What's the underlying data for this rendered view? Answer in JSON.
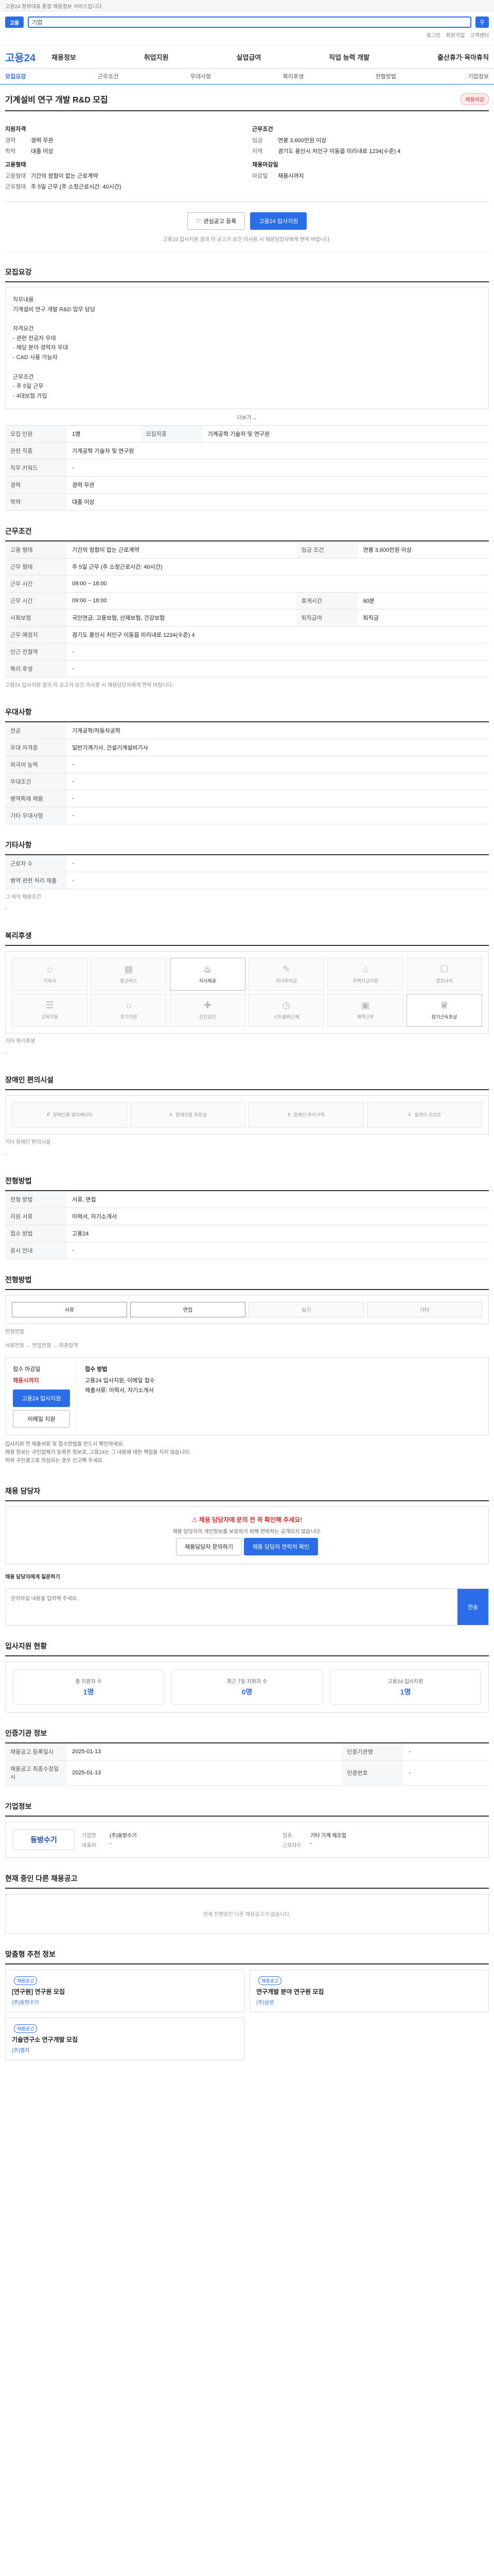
{
  "topbar": {
    "notice": "고용24 정부대표 통합 채용정보 서비스입니다"
  },
  "search": {
    "logo": "고용",
    "value": "기업",
    "util": [
      "로그인",
      "회원가입",
      "고객센터"
    ]
  },
  "nav": {
    "brand": "고용24",
    "menu": [
      "채용정보",
      "취업지원",
      "실업급여",
      "직업 능력 개발",
      "출산휴가·육아휴직"
    ]
  },
  "tabs": [
    "모집요강",
    "근무조건",
    "우대사항",
    "복리후생",
    "전형방법",
    "기업정보"
  ],
  "job": {
    "title": "기계설비 연구 개발 R&D 모집",
    "badge": "채용마감",
    "summary": {
      "left_h1": "지원자격",
      "left": [
        {
          "k": "경력",
          "v": "경력 무관"
        },
        {
          "k": "학력",
          "v": "대졸 이상"
        }
      ],
      "left_h2": "고용형태",
      "left2": [
        {
          "k": "고용형태",
          "v": "기간의 정함이 없는 근로계약"
        },
        {
          "k": "근무형태",
          "v": "주 5일 근무 (주 소정근로시간: 40시간)"
        }
      ],
      "right_h1": "근무조건",
      "right": [
        {
          "k": "임금",
          "v": "연봉 3,600만원 이상"
        },
        {
          "k": "지역",
          "v": "경기도 용인시 처인구 이동읍 미리내로 1234(수준) 4"
        }
      ],
      "right_h2": "채용마감일",
      "right2": [
        {
          "k": "마감일",
          "v": "채용시까지"
        }
      ]
    },
    "actions": {
      "save": "관심공고 등록",
      "apply": "고용24 입사지원"
    },
    "notice": "고용24 입사지원 결과 이 공고가 요건 미사용 시 채용담당자에게 연락 바랍니다."
  },
  "recruit": {
    "title": "모집요강",
    "content": "직무내용\n기계설비 연구 개발 R&D 업무 담당\n\n자격요건\n- 관련 전공자 우대\n- 해당 분야 경력자 우대\n- CAD 사용 가능자\n\n근무조건\n- 주 5일 근무\n- 4대보험 가입",
    "more": "더보기",
    "rows": [
      {
        "k": "모집 인원",
        "v": "1명",
        "k2": "모집직종",
        "v2": "기계공학 기술자 및 연구원"
      },
      {
        "k": "관련 직종",
        "v": "기계공학 기술자 및 연구원"
      },
      {
        "k": "직무 키워드",
        "v": "-"
      },
      {
        "k": "경력",
        "v": "경력 무관"
      },
      {
        "k": "학력",
        "v": "대졸 이상"
      }
    ]
  },
  "work": {
    "title": "근무조건",
    "rows": [
      {
        "k": "고용 형태",
        "v": "기간의 정함이 없는 근로계약",
        "k2": "임금 조건",
        "v2": "연봉 3,600만원 이상"
      },
      {
        "k": "근무 형태",
        "v": "주 5일 근무 (주 소정근로시간: 40시간)"
      },
      {
        "k": "근무 시간",
        "v": "09:00 ~ 18:00"
      },
      {
        "k": "근무 시간",
        "v": "09:00 ~ 18:00",
        "k2": "휴게시간",
        "v2": "60분"
      },
      {
        "k": "사회보험",
        "v": "국민연금, 고용보험, 산재보험, 건강보험",
        "k2": "퇴직급여",
        "v2": "퇴직금"
      },
      {
        "k": "근무 예정지",
        "v": "경기도 용인시 처인구 이동읍 미리내로 1234(수준) 4"
      },
      {
        "k": "인근 전철역",
        "v": "-"
      },
      {
        "k": "복리 후생",
        "v": "-"
      }
    ],
    "note": "고용24 입사지원 결과 이 공고가 요건 미사용 시 채용담당자에게 연락 바랍니다."
  },
  "pref": {
    "title": "우대사항",
    "rows": [
      {
        "k": "전공",
        "v": "기계공학/자동차공학"
      },
      {
        "k": "우대 자격증",
        "v": "일반기계기사, 건설기계설비기사"
      },
      {
        "k": "외국어 능력",
        "v": "-"
      },
      {
        "k": "우대조건",
        "v": "-"
      },
      {
        "k": "병역특례 채용",
        "v": "-"
      },
      {
        "k": "기타 우대사항",
        "v": "-"
      }
    ]
  },
  "etc": {
    "title": "기타사항",
    "rows": [
      {
        "k": "근로자 수",
        "v": "-"
      },
      {
        "k": "병역 관련 처리 제출",
        "v": "-"
      }
    ],
    "note_title": "그 외의 채용조건",
    "note": "-"
  },
  "welfare": {
    "title": "복리후생",
    "items": [
      "기숙사",
      "통근버스",
      "식사제공",
      "자녀학자금",
      "주택자금지원",
      "경조사비",
      "교육지원",
      "휴가지원",
      "건강검진",
      "시차출퇴근제",
      "재택근무",
      "장기근속포상"
    ],
    "note_title": "기타 복리후생",
    "note": "-"
  },
  "facility": {
    "title": "장애인 편의시설",
    "items": [
      "장애인용 엘리베이터",
      "장애인용 화장실",
      "장애인 주차구역",
      "휠체어 리프트"
    ],
    "note_title": "기타 장애인 편의시설",
    "note": "-"
  },
  "process": {
    "title": "전형방법",
    "rows": [
      {
        "k": "전형 방법",
        "v": "서류, 면접",
        "k2": "",
        "v2": ""
      },
      {
        "k": "지원 서류",
        "v": "이력서, 자기소개서",
        "k2": "",
        "v2": ""
      },
      {
        "k": "접수 방법",
        "v": "고용24",
        "k2": "",
        "v2": ""
      },
      {
        "k": "응시 안내",
        "v": "-",
        "k2": "",
        "v2": ""
      }
    ],
    "steps": [
      "서류",
      "면접",
      "실기",
      "기타"
    ]
  },
  "apply": {
    "title": "전형방법",
    "method_label": "전형방법",
    "method": "서류전형 → 면접전형 → 최종합격",
    "left_title": "접수 마감일",
    "deadline": "채용시까지",
    "apply_btn": "고용24 입사지원",
    "email_btn": "이메일 지원",
    "right_title": "접수 방법",
    "right": "고용24 입사지원, 이메일 접수\n제출서류: 이력서, 자기소개서"
  },
  "bullets": [
    "입사지원 전 제출서류 및 접수방법을 반드시 확인하세요.",
    "채용 정보는 구인업체가 등록한 정보로, 고용24는 그 내용에 대한 책임을 지지 않습니다.",
    "허위 구인광고로 의심되는 경우 신고해 주세요."
  ],
  "contact": {
    "title": "채용 담당자",
    "alert": "채용 담당자에 문의 전 꼭 확인해 주세요!",
    "desc": "채용 담당자의 개인정보를 보호하기 위해 연락처는 공개되지 않습니다.",
    "btn1": "채용담당자 문의하기",
    "btn2": "채용 담당자 연락처 확인",
    "q_title": "채용 담당자에게 질문하기",
    "q_placeholder": "문의하실 내용을 입력해 주세요.",
    "q_send": "전송"
  },
  "stats": {
    "title": "입사지원 현황",
    "items": [
      {
        "k": "총 지원자 수",
        "v": "1명"
      },
      {
        "k": "최근 7일 지원자 수",
        "v": "0명"
      },
      {
        "k": "고용24 입사지원",
        "v": "1명"
      }
    ]
  },
  "history": {
    "title": "인증기관 정보",
    "rows": [
      {
        "k": "채용공고 등록일시",
        "v": "2025-01-13",
        "k2": "인증기관명",
        "v2": "-"
      },
      {
        "k": "채용공고 최종수정일시",
        "v": "2025-01-13",
        "k2": "인증번호",
        "v2": "-"
      }
    ]
  },
  "company": {
    "title": "기업정보",
    "logo": "동방수기",
    "info": [
      {
        "k": "기업명",
        "v": "(주)동방수기"
      },
      {
        "k": "업종",
        "v": "기타 기계 제조업"
      },
      {
        "k": "대표자",
        "v": "-"
      },
      {
        "k": "근로자수",
        "v": "-"
      }
    ]
  },
  "related": {
    "title": "현재 중인 다른 채용공고",
    "empty": "현재 진행중인 다른 채용공고가 없습니다."
  },
  "recommend": {
    "title": "맞춤형 추천 정보",
    "items": [
      {
        "badge": "채용공고",
        "title": "[연구원] 연구원 모집",
        "company": "(주)동방수기"
      },
      {
        "badge": "채용공고",
        "title": "연구개발 분야 연구원 모집",
        "company": "(주)삼성"
      },
      {
        "badge": "채용공고",
        "title": "기술연구소 연구개발 모집",
        "company": "(주)엘지"
      }
    ]
  }
}
